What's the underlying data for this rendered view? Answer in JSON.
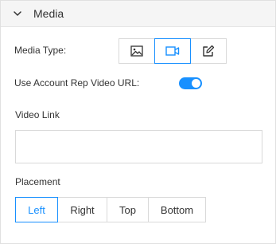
{
  "panel": {
    "title": "Media",
    "expanded": true
  },
  "media_type": {
    "label": "Media Type:",
    "options": [
      {
        "icon": "image-icon",
        "selected": false
      },
      {
        "icon": "video-icon",
        "selected": true
      },
      {
        "icon": "edit-icon",
        "selected": false
      }
    ]
  },
  "account_rep_video": {
    "label": "Use Account Rep Video URL:",
    "on": true
  },
  "video_link": {
    "label": "Video Link",
    "value": "",
    "placeholder": ""
  },
  "placement": {
    "label": "Placement",
    "options": [
      "Left",
      "Right",
      "Top",
      "Bottom"
    ],
    "selected": "Left"
  },
  "colors": {
    "accent": "#1890ff",
    "border": "#d9d9d9",
    "header_bg": "#f5f5f5",
    "text": "#333333"
  }
}
